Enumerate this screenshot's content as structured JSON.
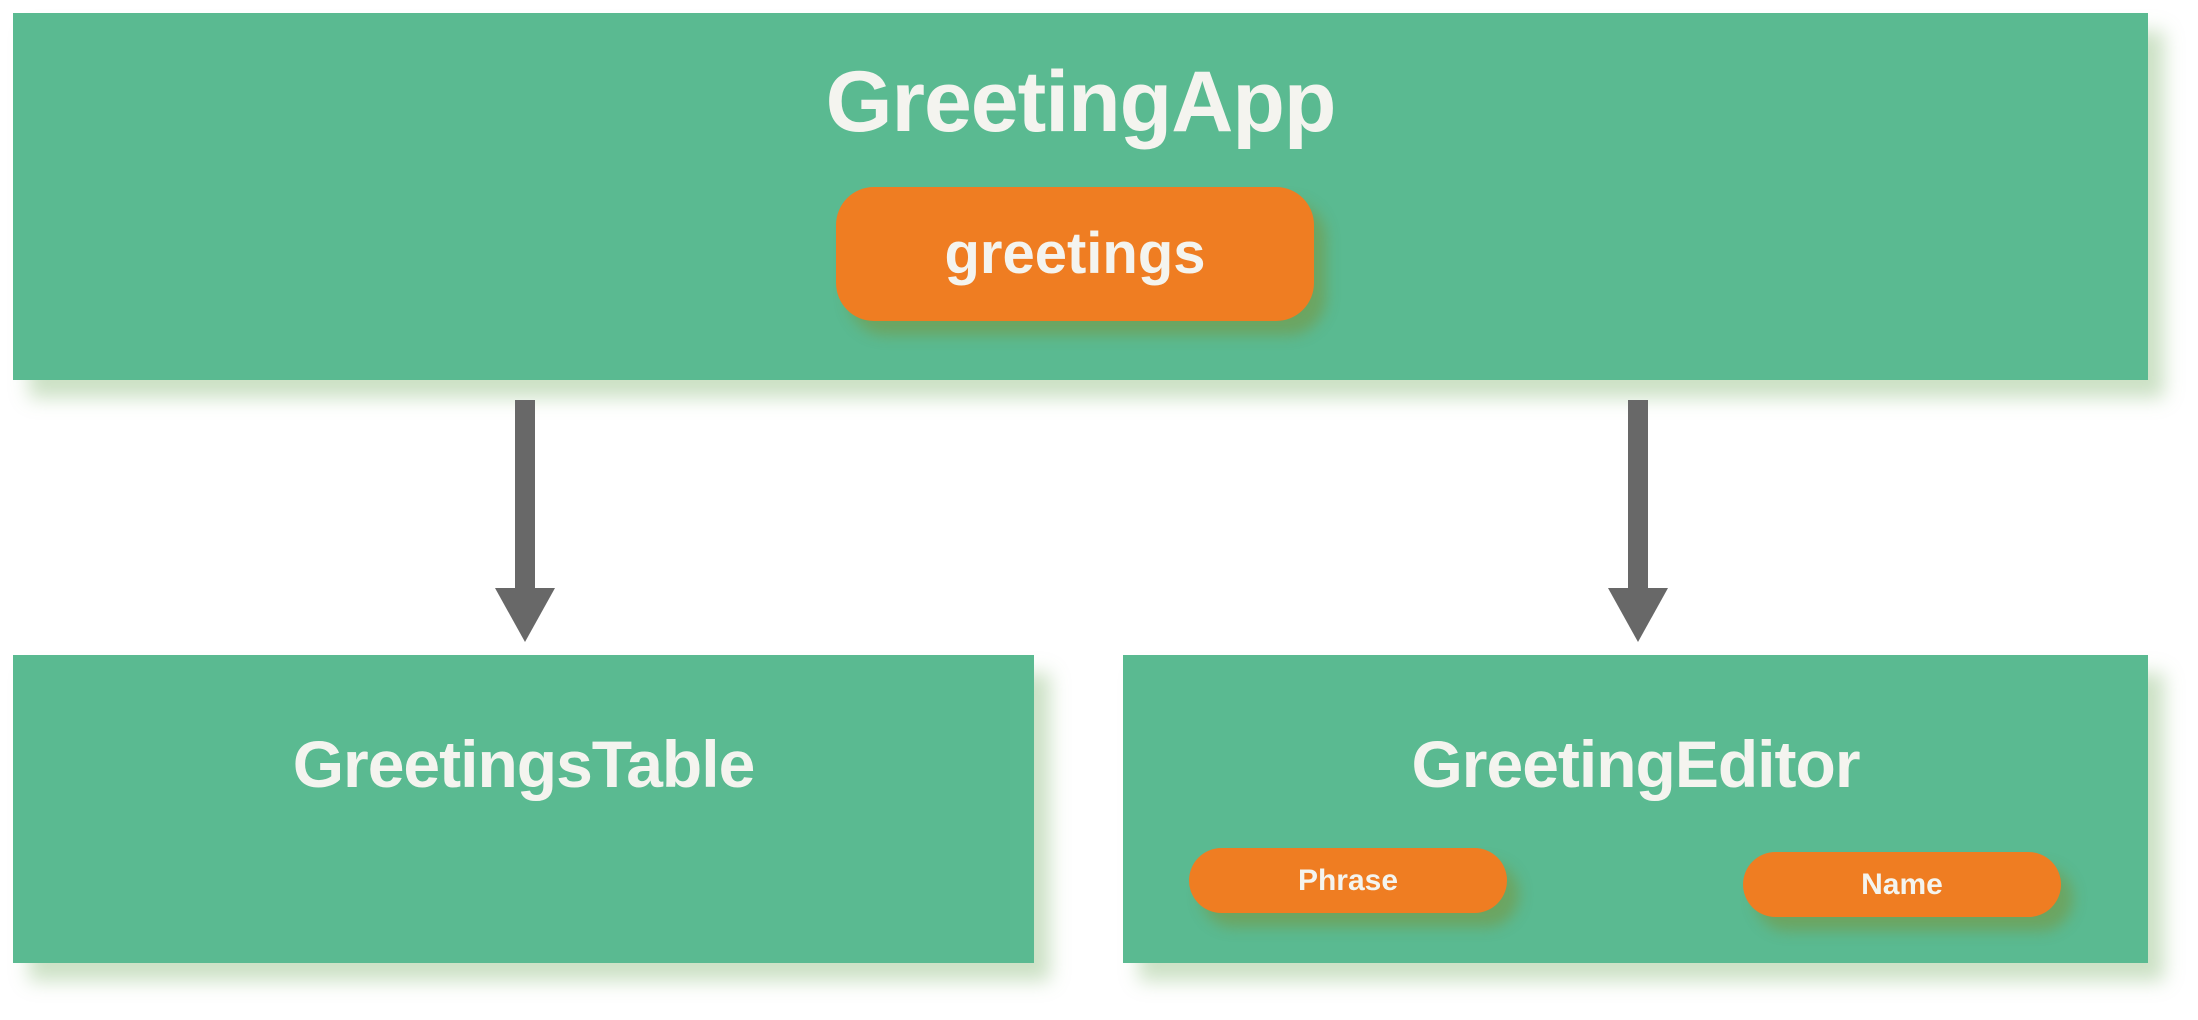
{
  "nodes": {
    "app": {
      "title": "GreetingApp",
      "state_label": "greetings"
    },
    "table": {
      "title": "GreetingsTable"
    },
    "editor": {
      "title": "GreetingEditor",
      "fields": [
        "Phrase",
        "Name"
      ]
    }
  },
  "edges": [
    {
      "from": "GreetingApp",
      "to": "GreetingsTable"
    },
    {
      "from": "GreetingApp",
      "to": "GreetingEditor"
    }
  ],
  "colors": {
    "box": "#5aba91",
    "pill": "#ef7d22",
    "text": "#f4f4ef",
    "arrow": "#686868"
  }
}
